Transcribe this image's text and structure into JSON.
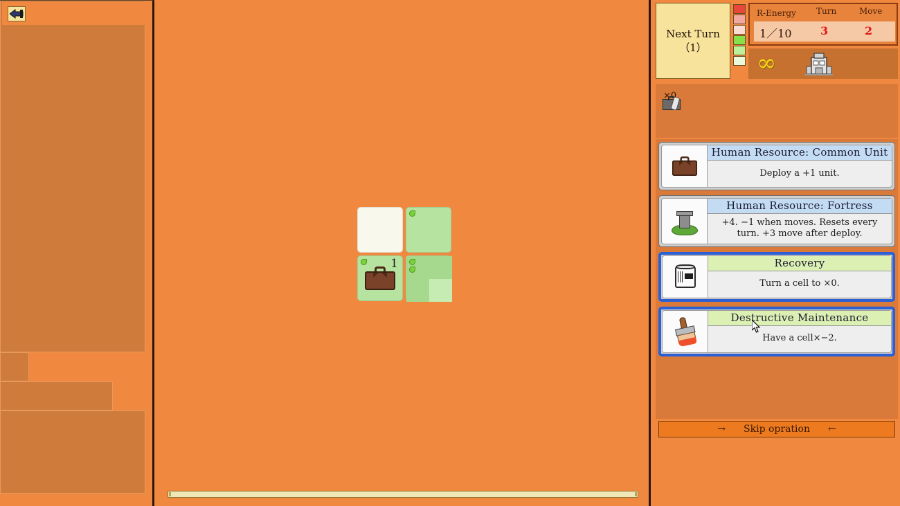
{
  "left_panel": {
    "back_button_icon": "back-arrow-icon"
  },
  "board": {
    "cells": [
      {
        "id": "r0c0",
        "color": "white",
        "dots": 0,
        "number": "",
        "unit": "none"
      },
      {
        "id": "r0c1",
        "color": "green",
        "dots": 1,
        "number": "",
        "unit": "none"
      },
      {
        "id": "r1c0",
        "color": "green",
        "dots": 1,
        "number": "1",
        "unit": "briefcase-icon"
      },
      {
        "id": "r1c1",
        "color": "checkered",
        "dots": 2,
        "number": "",
        "unit": "none"
      }
    ]
  },
  "status": {
    "next_turn_line1": "Next Turn",
    "next_turn_line2": "（1）",
    "labels": {
      "r_energy": "R-Energy",
      "turn": "Turn",
      "move": "Move"
    },
    "values": {
      "r_energy": "1／10",
      "turn": "3",
      "move": "2"
    },
    "legend_colors": [
      "#e8473c",
      "#f2a8a0",
      "#fadbd5",
      "#86e04a",
      "#bdf09a",
      "#eaf8dc"
    ],
    "infinity_symbol": "∞",
    "factory_icon": "factory-icon",
    "accent_red": "#e01616",
    "accent_yellow": "#f5d11a"
  },
  "inventory": {
    "item_icon": "toolkit-icon",
    "item_count": "×0"
  },
  "cards": [
    {
      "title": "Human Resource: Common Unit",
      "desc": "Deploy a +1 unit.",
      "icon": "briefcase-icon",
      "title_style": "blue",
      "selected": false
    },
    {
      "title": "Human Resource: Fortress",
      "desc": "+4. −1 when moves. Resets every turn. +3 move after deploy.",
      "icon": "fortress-icon",
      "title_style": "blue",
      "selected": false
    },
    {
      "title": "Recovery",
      "desc": "Turn a cell to ×0.",
      "icon": "paint-can-icon",
      "title_style": "green",
      "selected": true
    },
    {
      "title": "Destructive Maintenance",
      "desc": "Have a cell×−2.",
      "icon": "paint-brush-icon",
      "title_style": "green",
      "selected": true
    }
  ],
  "footer": {
    "skip_left_arrow": "→",
    "skip_label": "Skip opration",
    "skip_right_arrow": "←"
  }
}
